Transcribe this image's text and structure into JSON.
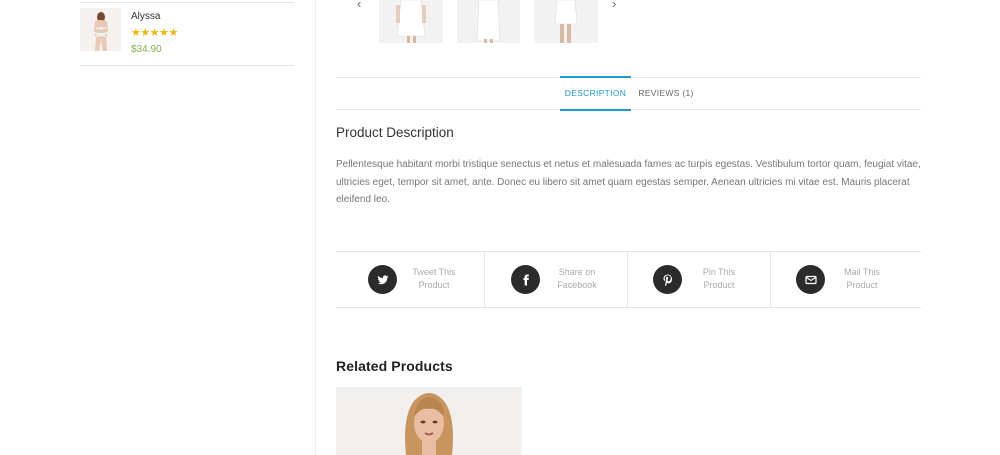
{
  "sidebar": {
    "product": {
      "name": "Alyssa",
      "rating": 5,
      "stars": "★★★★★",
      "price": "$34.90"
    }
  },
  "gallery": {
    "prev_icon": "chevron-left-icon",
    "next_icon": "chevron-right-icon",
    "prev_glyph": "‹",
    "next_glyph": "›"
  },
  "tabs": [
    {
      "label": "DESCRIPTION",
      "active": true
    },
    {
      "label": "REVIEWS (1)",
      "active": false
    }
  ],
  "description": {
    "title": "Product Description",
    "body": "Pellentesque habitant morbi tristique senectus et netus et malesuada fames ac turpis egestas. Vestibulum tortor quam, feugiat vitae, ultricies eget, tempor sit amet, ante. Donec eu libero sit amet quam egestas semper. Aenean ultricies mi vitae est. Mauris placerat eleifend leo."
  },
  "share": [
    {
      "icon": "twitter-icon",
      "line1": "Tweet This",
      "line2": "Product"
    },
    {
      "icon": "facebook-icon",
      "line1": "Share on",
      "line2": "Facebook"
    },
    {
      "icon": "pinterest-icon",
      "line1": "Pin This",
      "line2": "Product"
    },
    {
      "icon": "mail-icon",
      "line1": "Mail This",
      "line2": "Product"
    }
  ],
  "related": {
    "title": "Related Products"
  },
  "colors": {
    "accent": "#1b9ad6",
    "price": "#88b04b",
    "star": "#f2b600",
    "share_circle": "#2b2b2b"
  }
}
